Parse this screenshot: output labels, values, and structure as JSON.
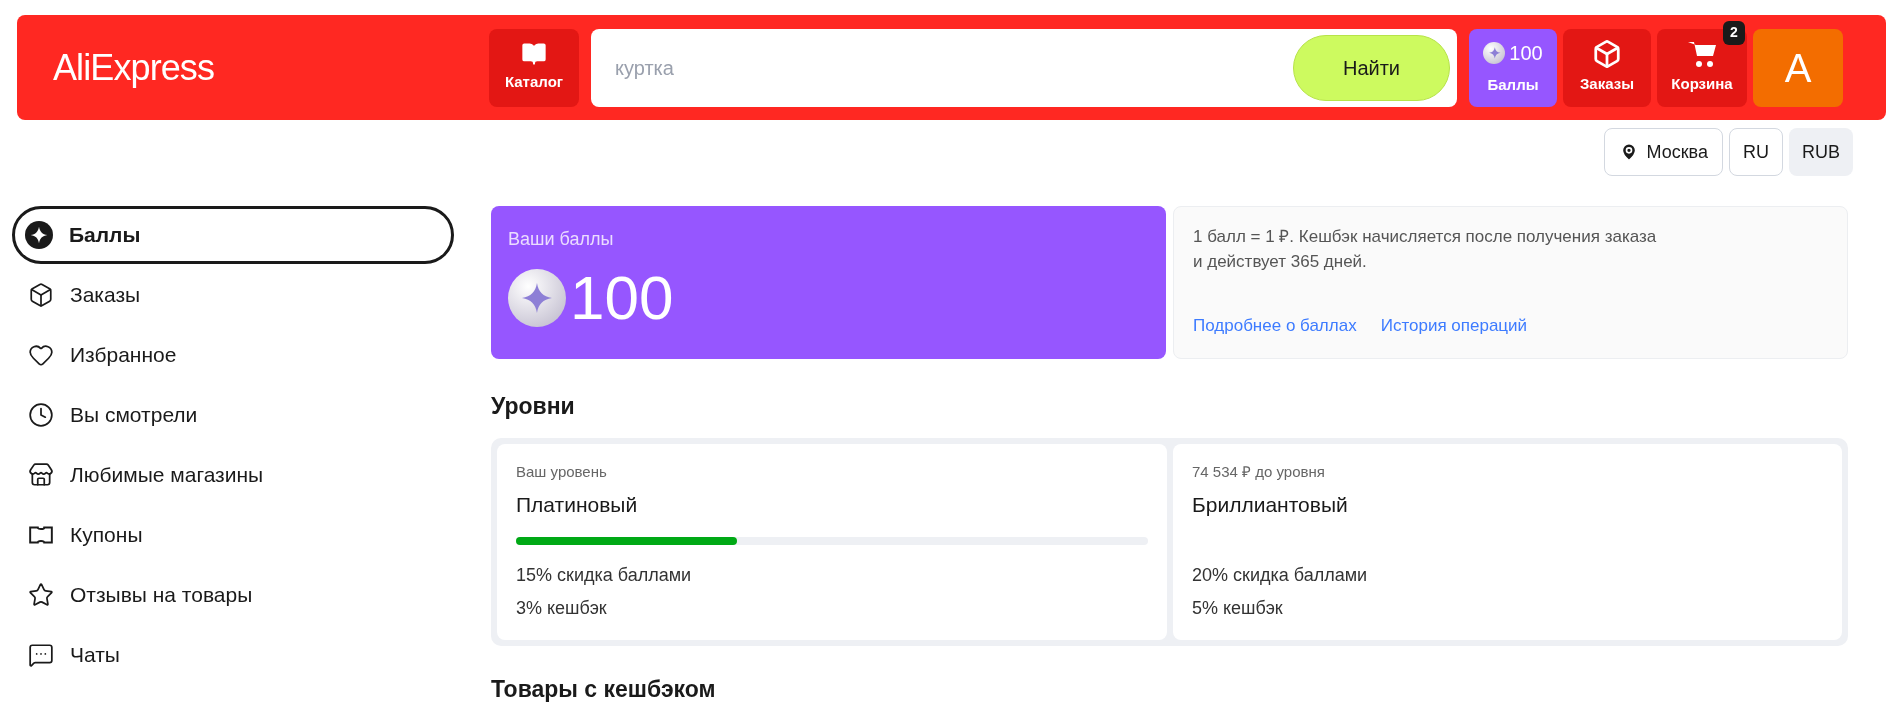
{
  "header": {
    "logo": "AliExpress",
    "catalog": {
      "label": "Каталог"
    },
    "search": {
      "placeholder": "куртка",
      "button": "Найти"
    },
    "points": {
      "value": "100",
      "label": "Баллы"
    },
    "orders": {
      "label": "Заказы"
    },
    "cart": {
      "label": "Корзина",
      "badge": "2"
    },
    "avatar": {
      "letter": "A"
    }
  },
  "locale_bar": {
    "city": "Москва",
    "language": "RU",
    "currency": "RUB"
  },
  "sidebar": {
    "items": [
      {
        "label": "Баллы",
        "selected": true
      },
      {
        "label": "Заказы",
        "selected": false
      },
      {
        "label": "Избранное",
        "selected": false
      },
      {
        "label": "Вы смотрели",
        "selected": false
      },
      {
        "label": "Любимые магазины",
        "selected": false
      },
      {
        "label": "Купоны",
        "selected": false
      },
      {
        "label": "Отзывы на товары",
        "selected": false
      },
      {
        "label": "Чаты",
        "selected": false
      }
    ]
  },
  "points_card": {
    "title": "Ваши баллы",
    "value": "100"
  },
  "info_card": {
    "text": "1 балл = 1 ₽. Кешбэк начисляется после получения заказа\nи действует 365 дней.",
    "links": [
      "Подробнее о баллах",
      "История операций"
    ]
  },
  "levels": {
    "title": "Уровни",
    "cards": [
      {
        "caption": "Ваш уровень",
        "name": "Платиновый",
        "level": 0.35,
        "perks": [
          "15% скидка баллами",
          "3% кешбэк"
        ]
      },
      {
        "caption": "74 534 ₽ до уровня",
        "name": "Бриллиантовый",
        "perks": [
          "20% скидка баллами",
          "5% кешбэк"
        ]
      }
    ]
  },
  "cashback_title": "Товары с кешбэком"
}
